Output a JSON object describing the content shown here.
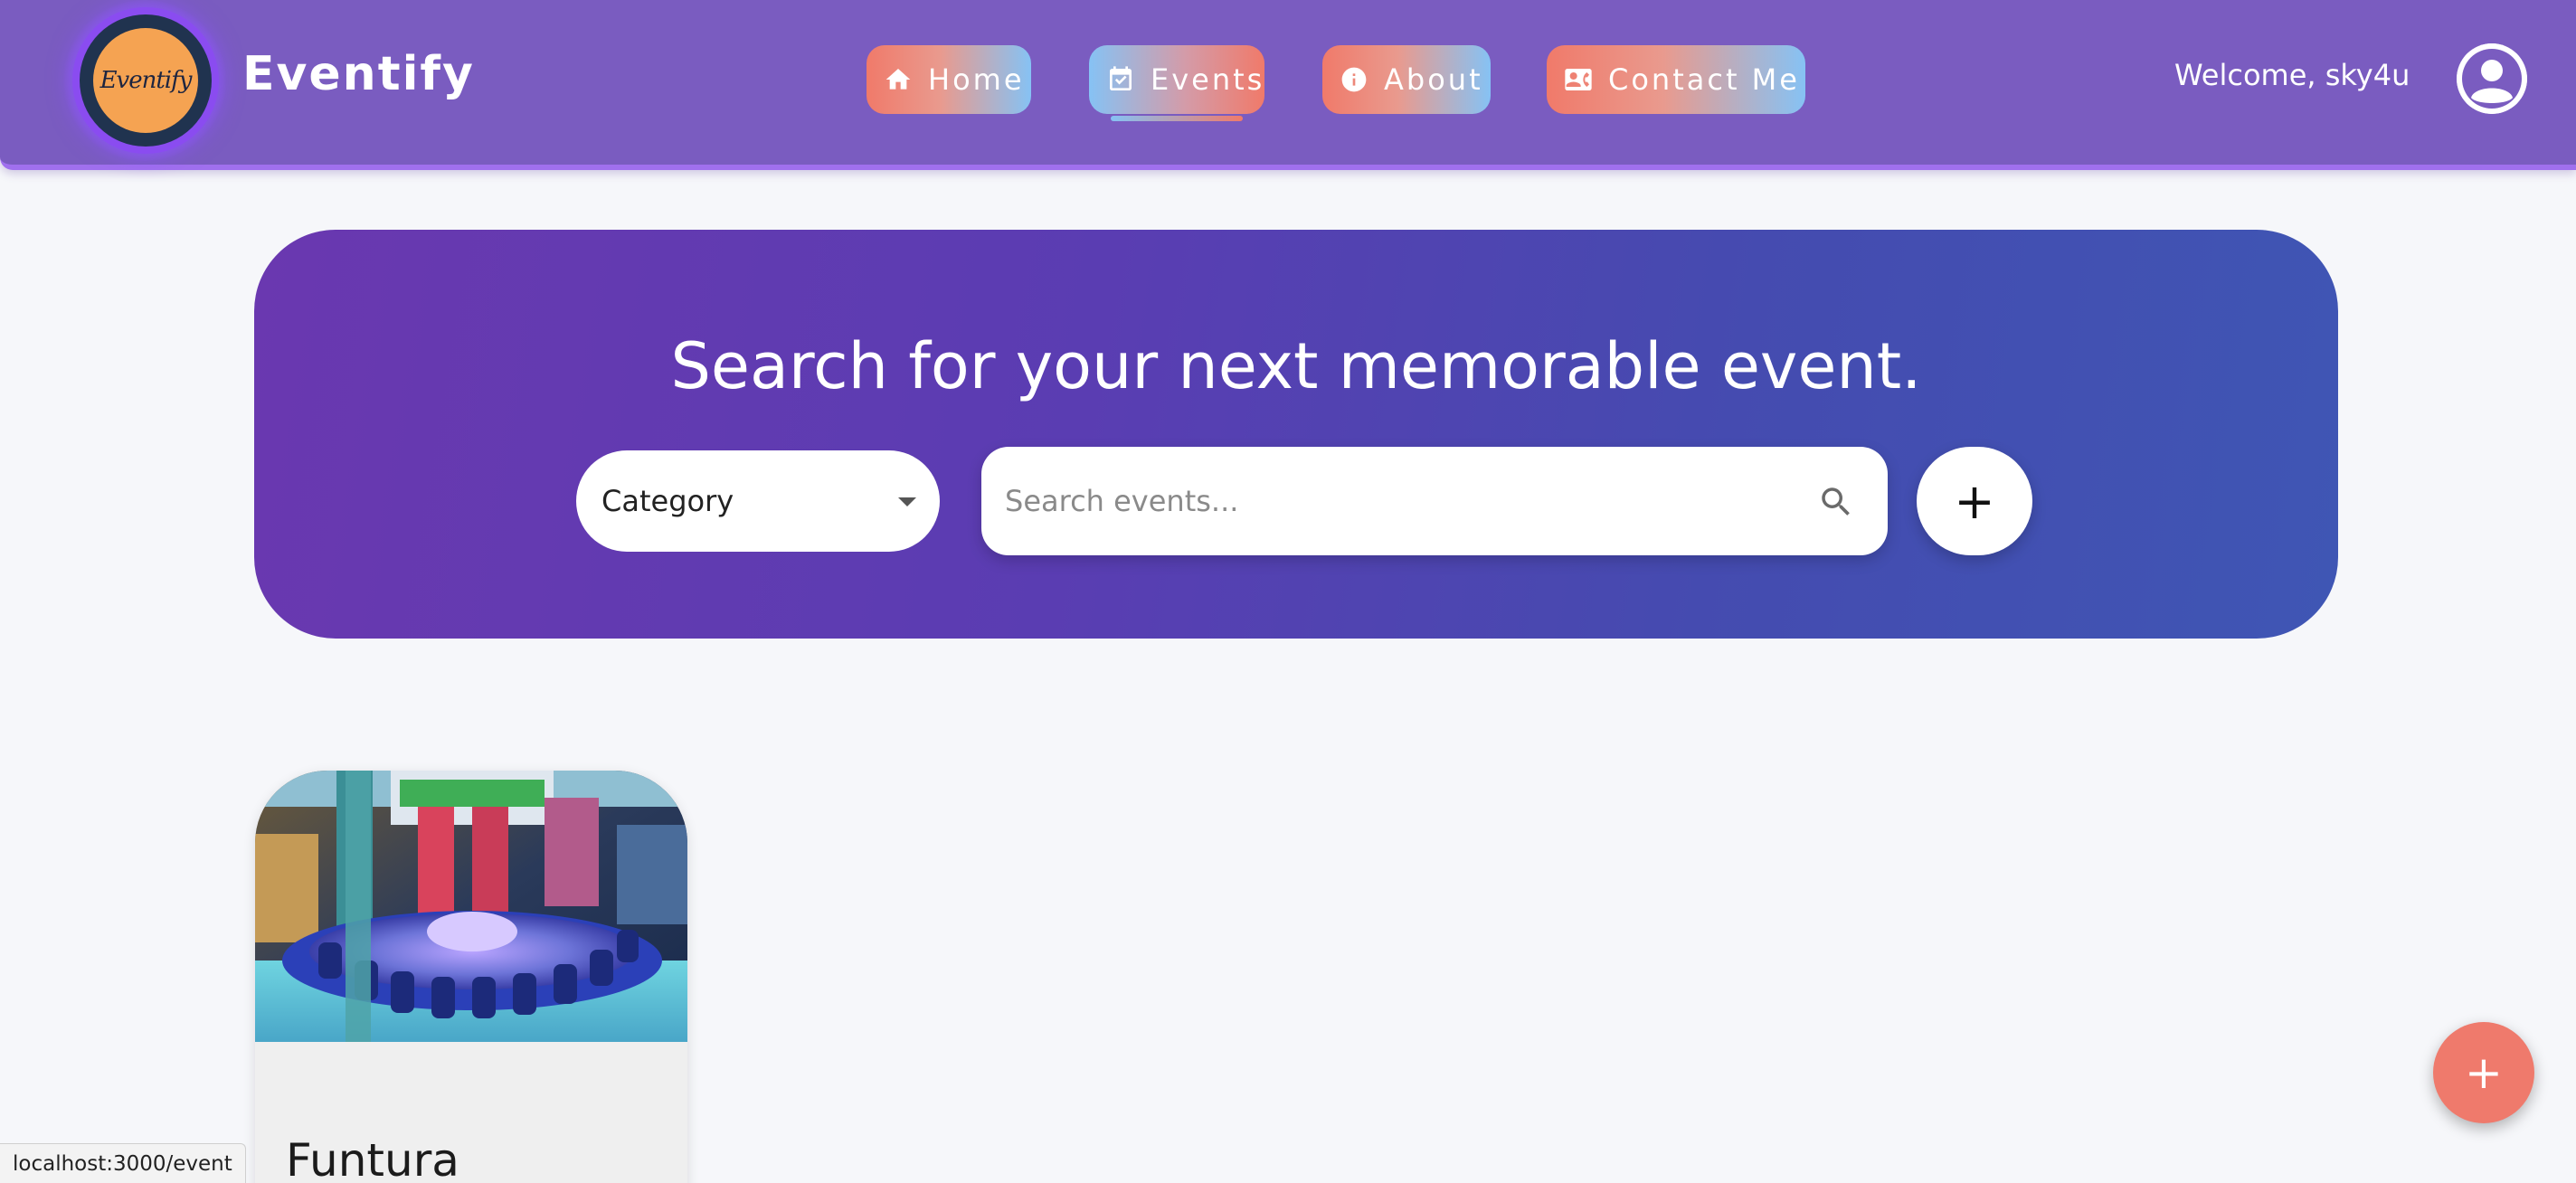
{
  "header": {
    "logo_text": "Eventify",
    "brand": "Eventify",
    "nav": [
      {
        "label": "Home",
        "icon": "home-icon"
      },
      {
        "label": "Events",
        "icon": "calendar-check-icon",
        "active": true
      },
      {
        "label": "About",
        "icon": "info-icon"
      },
      {
        "label": "Contact Me",
        "icon": "contact-card-icon"
      }
    ],
    "welcome": "Welcome, sky4u",
    "avatar_icon": "user-circle-icon"
  },
  "hero": {
    "title": "Search for your next memorable event.",
    "category_label": "Category",
    "search_placeholder": "Search events...",
    "add_label": "+"
  },
  "events": [
    {
      "title": "Funtura"
    }
  ],
  "fab_label": "+",
  "status_url": "localhost:3000/event",
  "colors": {
    "navbar": "#7a5cc0",
    "accent_coral": "#ef7a6c",
    "accent_blue": "#86c2f4",
    "hero_start": "#6a38b0",
    "hero_end": "#3f56b4"
  }
}
